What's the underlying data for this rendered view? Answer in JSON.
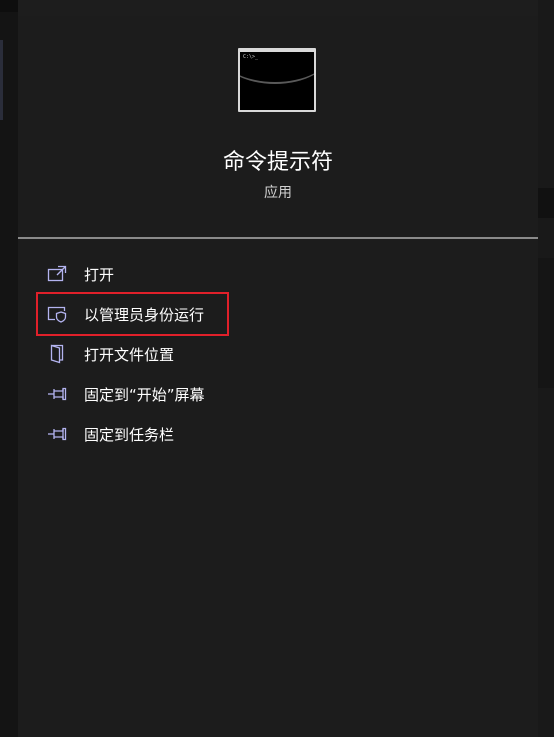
{
  "app": {
    "title": "命令提示符",
    "type": "应用",
    "icon": "command-prompt-icon",
    "icon_prompt": "C:\\>_"
  },
  "menu": {
    "items": [
      {
        "label": "打开",
        "icon": "open-external-icon"
      },
      {
        "label": "以管理员身份运行",
        "icon": "shield-window-icon"
      },
      {
        "label": "打开文件位置",
        "icon": "folder-icon"
      },
      {
        "label": "固定到“开始”屏幕",
        "icon": "pin-icon"
      },
      {
        "label": "固定到任务栏",
        "icon": "pin-icon"
      }
    ]
  },
  "colors": {
    "background": "#1c1c1c",
    "icon_accent": "#b4b4f0",
    "highlight": "#e0202a"
  }
}
